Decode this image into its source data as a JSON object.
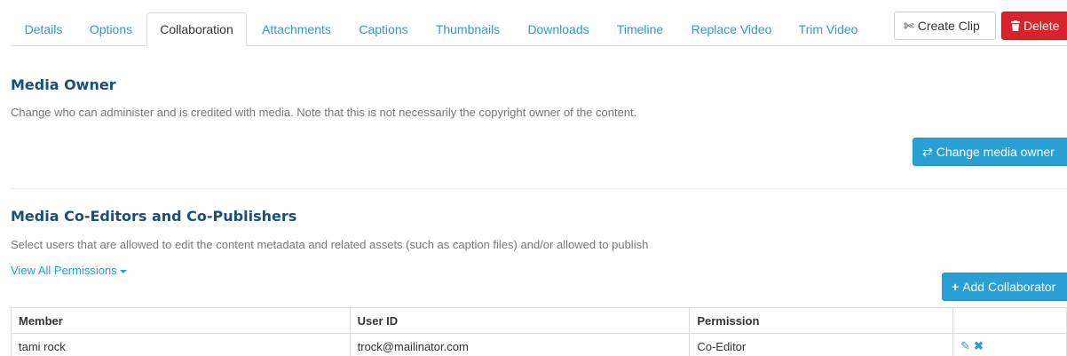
{
  "tabs": [
    {
      "label": "Details"
    },
    {
      "label": "Options"
    },
    {
      "label": "Collaboration",
      "active": true
    },
    {
      "label": "Attachments"
    },
    {
      "label": "Captions"
    },
    {
      "label": "Thumbnails"
    },
    {
      "label": "Downloads"
    },
    {
      "label": "Timeline"
    },
    {
      "label": "Replace Video"
    },
    {
      "label": "Trim Video"
    }
  ],
  "actions": {
    "create_clip": {
      "label": "Create Clip",
      "icon": "scissors-icon"
    },
    "delete": {
      "label": "Delete",
      "icon": "trash-icon"
    }
  },
  "owner": {
    "title": "Media Owner",
    "description": "Change who can administer and is credited with media. Note that this is not necessarily the copyright owner of the content.",
    "button": {
      "label": "Change media owner",
      "icon": "swap-arrows-icon"
    }
  },
  "coeditors": {
    "title": "Media Co-Editors and Co-Publishers",
    "description": "Select users that are allowed to edit the content metadata and related assets (such as caption files) and/or allowed to publish",
    "view_all_link": "View All Permissions",
    "add_button": {
      "label": "Add Collaborator",
      "icon": "plus-icon"
    },
    "table": {
      "headers": [
        "Member",
        "User ID",
        "Permission",
        ""
      ],
      "rows": [
        {
          "member": "tami rock",
          "user_id": "trock@mailinator.com",
          "permission": "Co-Editor"
        }
      ]
    }
  },
  "colors": {
    "link_blue": "#2a9bd6",
    "primary_button": "#2a9fd6",
    "danger_button": "#d9232b",
    "heading": "#1b4f7a"
  }
}
